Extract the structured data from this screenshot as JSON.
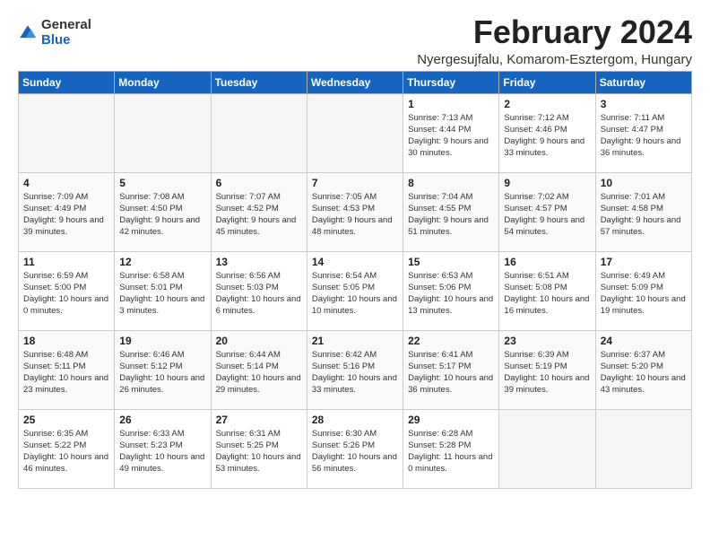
{
  "header": {
    "logo_general": "General",
    "logo_blue": "Blue",
    "title": "February 2024",
    "subtitle": "Nyergesujfalu, Komarom-Esztergom, Hungary"
  },
  "weekdays": [
    "Sunday",
    "Monday",
    "Tuesday",
    "Wednesday",
    "Thursday",
    "Friday",
    "Saturday"
  ],
  "weeks": [
    [
      {
        "day": "",
        "info": ""
      },
      {
        "day": "",
        "info": ""
      },
      {
        "day": "",
        "info": ""
      },
      {
        "day": "",
        "info": ""
      },
      {
        "day": "1",
        "info": "Sunrise: 7:13 AM\nSunset: 4:44 PM\nDaylight: 9 hours\nand 30 minutes."
      },
      {
        "day": "2",
        "info": "Sunrise: 7:12 AM\nSunset: 4:46 PM\nDaylight: 9 hours\nand 33 minutes."
      },
      {
        "day": "3",
        "info": "Sunrise: 7:11 AM\nSunset: 4:47 PM\nDaylight: 9 hours\nand 36 minutes."
      }
    ],
    [
      {
        "day": "4",
        "info": "Sunrise: 7:09 AM\nSunset: 4:49 PM\nDaylight: 9 hours\nand 39 minutes."
      },
      {
        "day": "5",
        "info": "Sunrise: 7:08 AM\nSunset: 4:50 PM\nDaylight: 9 hours\nand 42 minutes."
      },
      {
        "day": "6",
        "info": "Sunrise: 7:07 AM\nSunset: 4:52 PM\nDaylight: 9 hours\nand 45 minutes."
      },
      {
        "day": "7",
        "info": "Sunrise: 7:05 AM\nSunset: 4:53 PM\nDaylight: 9 hours\nand 48 minutes."
      },
      {
        "day": "8",
        "info": "Sunrise: 7:04 AM\nSunset: 4:55 PM\nDaylight: 9 hours\nand 51 minutes."
      },
      {
        "day": "9",
        "info": "Sunrise: 7:02 AM\nSunset: 4:57 PM\nDaylight: 9 hours\nand 54 minutes."
      },
      {
        "day": "10",
        "info": "Sunrise: 7:01 AM\nSunset: 4:58 PM\nDaylight: 9 hours\nand 57 minutes."
      }
    ],
    [
      {
        "day": "11",
        "info": "Sunrise: 6:59 AM\nSunset: 5:00 PM\nDaylight: 10 hours\nand 0 minutes."
      },
      {
        "day": "12",
        "info": "Sunrise: 6:58 AM\nSunset: 5:01 PM\nDaylight: 10 hours\nand 3 minutes."
      },
      {
        "day": "13",
        "info": "Sunrise: 6:56 AM\nSunset: 5:03 PM\nDaylight: 10 hours\nand 6 minutes."
      },
      {
        "day": "14",
        "info": "Sunrise: 6:54 AM\nSunset: 5:05 PM\nDaylight: 10 hours\nand 10 minutes."
      },
      {
        "day": "15",
        "info": "Sunrise: 6:53 AM\nSunset: 5:06 PM\nDaylight: 10 hours\nand 13 minutes."
      },
      {
        "day": "16",
        "info": "Sunrise: 6:51 AM\nSunset: 5:08 PM\nDaylight: 10 hours\nand 16 minutes."
      },
      {
        "day": "17",
        "info": "Sunrise: 6:49 AM\nSunset: 5:09 PM\nDaylight: 10 hours\nand 19 minutes."
      }
    ],
    [
      {
        "day": "18",
        "info": "Sunrise: 6:48 AM\nSunset: 5:11 PM\nDaylight: 10 hours\nand 23 minutes."
      },
      {
        "day": "19",
        "info": "Sunrise: 6:46 AM\nSunset: 5:12 PM\nDaylight: 10 hours\nand 26 minutes."
      },
      {
        "day": "20",
        "info": "Sunrise: 6:44 AM\nSunset: 5:14 PM\nDaylight: 10 hours\nand 29 minutes."
      },
      {
        "day": "21",
        "info": "Sunrise: 6:42 AM\nSunset: 5:16 PM\nDaylight: 10 hours\nand 33 minutes."
      },
      {
        "day": "22",
        "info": "Sunrise: 6:41 AM\nSunset: 5:17 PM\nDaylight: 10 hours\nand 36 minutes."
      },
      {
        "day": "23",
        "info": "Sunrise: 6:39 AM\nSunset: 5:19 PM\nDaylight: 10 hours\nand 39 minutes."
      },
      {
        "day": "24",
        "info": "Sunrise: 6:37 AM\nSunset: 5:20 PM\nDaylight: 10 hours\nand 43 minutes."
      }
    ],
    [
      {
        "day": "25",
        "info": "Sunrise: 6:35 AM\nSunset: 5:22 PM\nDaylight: 10 hours\nand 46 minutes."
      },
      {
        "day": "26",
        "info": "Sunrise: 6:33 AM\nSunset: 5:23 PM\nDaylight: 10 hours\nand 49 minutes."
      },
      {
        "day": "27",
        "info": "Sunrise: 6:31 AM\nSunset: 5:25 PM\nDaylight: 10 hours\nand 53 minutes."
      },
      {
        "day": "28",
        "info": "Sunrise: 6:30 AM\nSunset: 5:26 PM\nDaylight: 10 hours\nand 56 minutes."
      },
      {
        "day": "29",
        "info": "Sunrise: 6:28 AM\nSunset: 5:28 PM\nDaylight: 11 hours\nand 0 minutes."
      },
      {
        "day": "",
        "info": ""
      },
      {
        "day": "",
        "info": ""
      }
    ]
  ]
}
